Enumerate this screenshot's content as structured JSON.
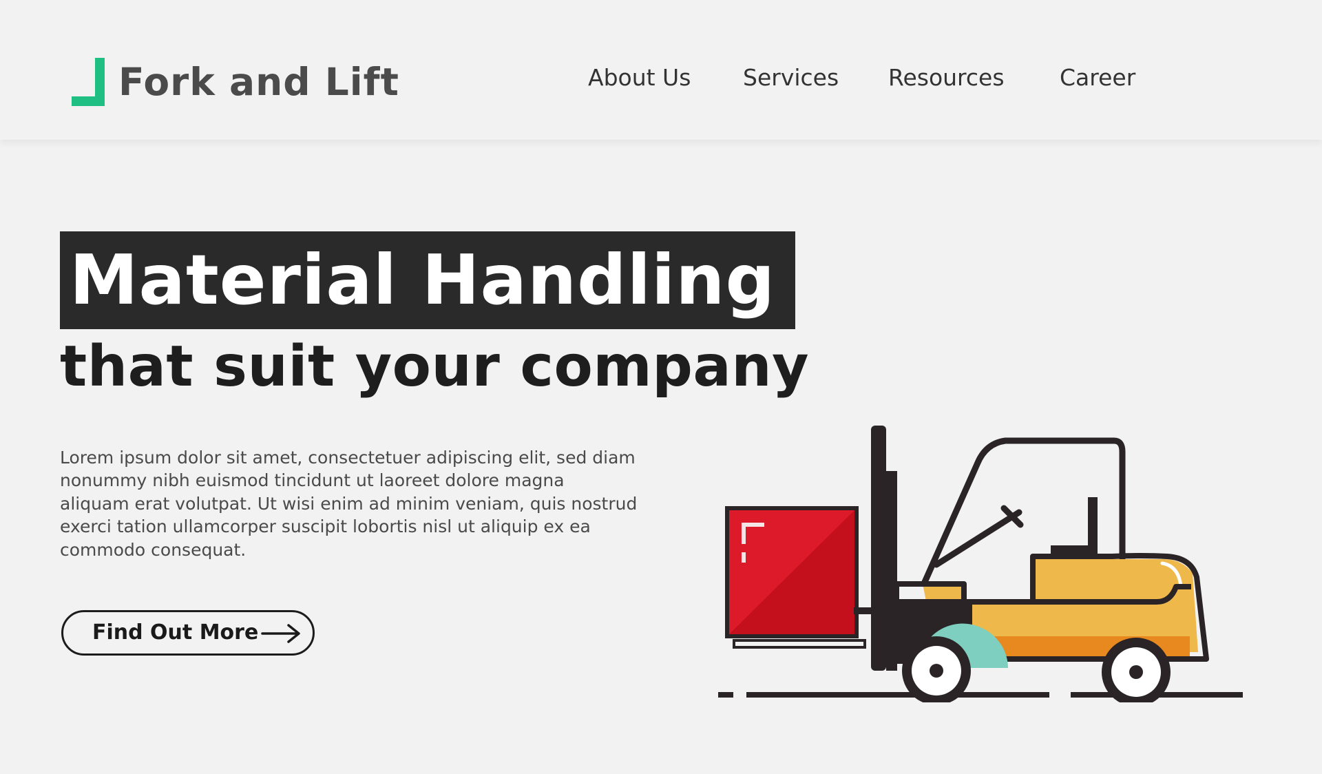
{
  "brand": {
    "name": "Fork and Lift",
    "accent_color": "#1fbf83"
  },
  "nav": {
    "items": [
      {
        "label": "About Us"
      },
      {
        "label": "Services"
      },
      {
        "label": "Resources"
      },
      {
        "label": "Career"
      }
    ]
  },
  "hero": {
    "title": "Material Handling",
    "subtitle": "that suit your company",
    "body": "Lorem ipsum dolor sit amet, consectetuer adipiscing elit, sed diam nonummy nibh euismod tincidunt ut laoreet dolore magna aliquam erat volutpat. Ut wisi enim ad minim veniam, quis nostrud exerci tation ullamcorper suscipit lobortis nisl ut aliquip ex ea commodo consequat.",
    "cta_label": "Find Out More",
    "cta_icon": "arrow-right-icon",
    "illustration": "forklift-illustration"
  },
  "colors": {
    "title_bg": "#2b2a2b",
    "forklift_body": "#efb84a",
    "forklift_stripe": "#e8891f",
    "cargo_box": "#dc1a2a",
    "outline": "#2a2426",
    "wheel_accent": "#7fcfc0"
  }
}
